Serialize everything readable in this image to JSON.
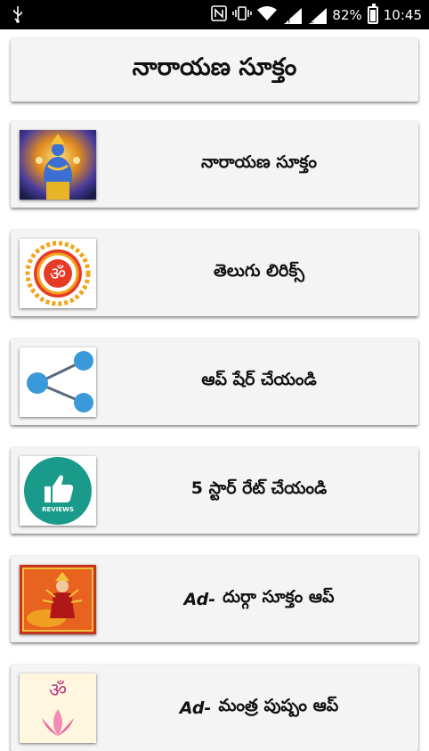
{
  "status_bar": {
    "battery": "82%",
    "time": "10:45",
    "icons": [
      "usb-icon",
      "nfc-icon",
      "vibrate-icon",
      "wifi-icon",
      "signal-icon",
      "signal-icon",
      "battery-icon"
    ]
  },
  "header": {
    "title": "నారాయణ సూక్తం"
  },
  "items": [
    {
      "label": "నారాయణ సూక్తం",
      "icon": "vishnu-image"
    },
    {
      "label": "తెలుగు లిరిక్స్",
      "icon": "om-icon"
    },
    {
      "label": "ఆప్ షేర్ చేయండి",
      "icon": "share-icon"
    },
    {
      "label": "5 స్టార్ రేట్ చేయండి",
      "icon": "reviews-thumbs-up-icon",
      "badge": "REVIEWS"
    },
    {
      "ad": "Ad-",
      "label": "దుర్గా సూక్తం ఆప్",
      "icon": "durga-image"
    },
    {
      "ad": "Ad-",
      "label": "మంత్ర పుష్పం ఆప్",
      "icon": "om-lotus-image"
    }
  ],
  "colors": {
    "card_bg": "#f4f4f4",
    "status_bg": "#000000",
    "share_blue": "#3a9ad9",
    "reviews_teal": "#1a9a8a"
  }
}
